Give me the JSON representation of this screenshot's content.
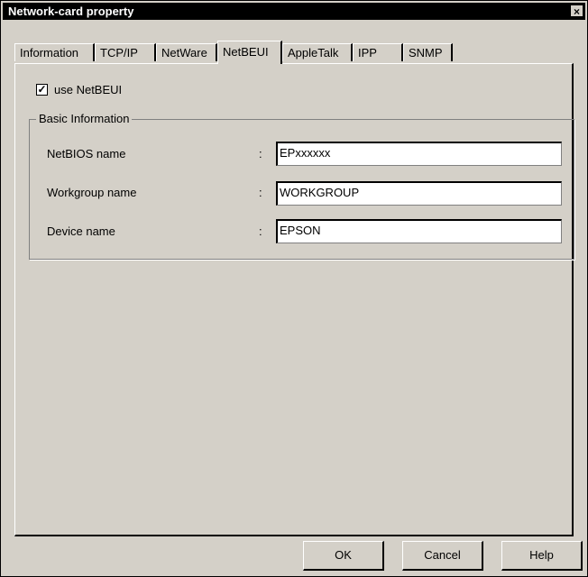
{
  "window": {
    "title": "Network-card property",
    "close_glyph": "×"
  },
  "tabs": [
    {
      "label": "Information"
    },
    {
      "label": "TCP/IP"
    },
    {
      "label": "NetWare"
    },
    {
      "label": "NetBEUI"
    },
    {
      "label": "AppleTalk"
    },
    {
      "label": "IPP"
    },
    {
      "label": "SNMP"
    }
  ],
  "active_tab": "NetBEUI",
  "netbeui": {
    "use_checkbox": {
      "label": "use NetBEUI",
      "checked": true,
      "check_glyph": "✓"
    },
    "group_title": "Basic Information",
    "colon": ":",
    "fields": [
      {
        "label": "NetBIOS name",
        "value": "EPxxxxxx"
      },
      {
        "label": "Workgroup name",
        "value": "WORKGROUP"
      },
      {
        "label": "Device name",
        "value": "EPSON"
      }
    ]
  },
  "buttons": {
    "ok": "OK",
    "cancel": "Cancel",
    "help": "Help"
  }
}
